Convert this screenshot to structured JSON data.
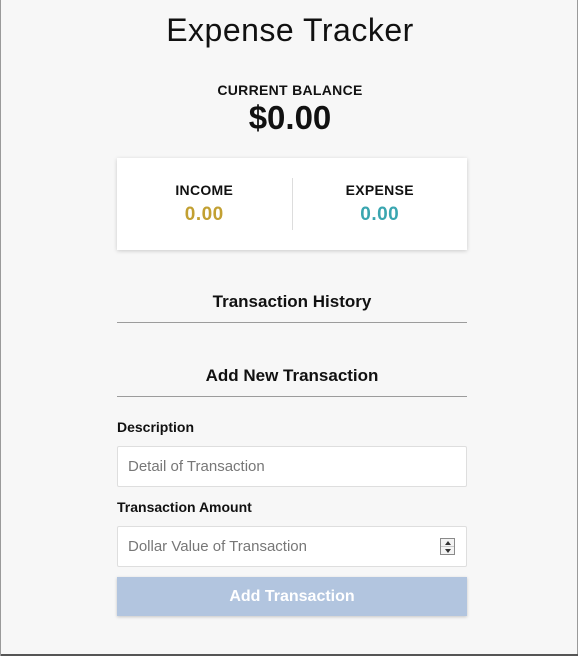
{
  "app": {
    "title": "Expense Tracker"
  },
  "balance": {
    "label": "CURRENT BALANCE",
    "value": "$0.00"
  },
  "summary": {
    "income_label": "INCOME",
    "income_value": "0.00",
    "expense_label": "EXPENSE",
    "expense_value": "0.00"
  },
  "history": {
    "heading": "Transaction History"
  },
  "form": {
    "heading": "Add New Transaction",
    "description_label": "Description",
    "description_placeholder": "Detail of Transaction",
    "description_value": "",
    "amount_label": "Transaction Amount",
    "amount_placeholder": "Dollar Value of Transaction",
    "amount_value": "",
    "submit_label": "Add Transaction"
  },
  "colors": {
    "income": "#c2a032",
    "expense": "#3aa6b0",
    "button": "#b2c5df"
  },
  "icons": {
    "spinner": "number-spinner-icon"
  }
}
